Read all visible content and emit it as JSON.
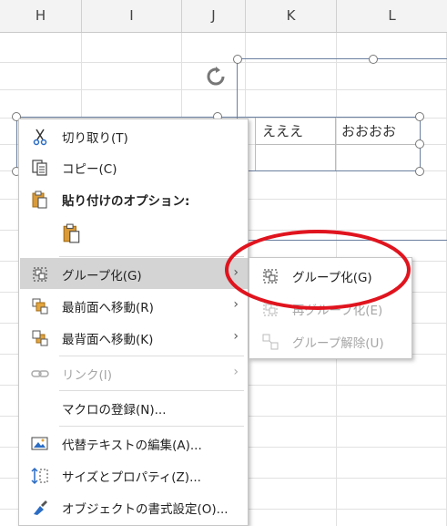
{
  "columns": [
    "H",
    "I",
    "J",
    "K",
    "L"
  ],
  "table_cells": [
    "えええ",
    "おおおお"
  ],
  "context_menu": {
    "items": [
      {
        "label": "切り取り(T)",
        "icon": "scissors-icon"
      },
      {
        "label": "コピー(C)",
        "icon": "copy-icon"
      },
      {
        "label": "貼り付けのオプション:",
        "icon": "paste-options-icon"
      },
      {
        "label": "グループ化(G)",
        "icon": "group-icon",
        "highlighted": true,
        "submenu": true
      },
      {
        "label": "最前面へ移動(R)",
        "icon": "bring-front-icon",
        "submenu": true
      },
      {
        "label": "最背面へ移動(K)",
        "icon": "send-back-icon",
        "submenu": true
      },
      {
        "label": "リンク(I)",
        "icon": "link-icon",
        "disabled": true,
        "submenu": true
      },
      {
        "label": "マクロの登録(N)...",
        "icon": ""
      },
      {
        "label": "代替テキストの編集(A)...",
        "icon": "alt-text-icon"
      },
      {
        "label": "サイズとプロパティ(Z)...",
        "icon": "size-properties-icon"
      },
      {
        "label": "オブジェクトの書式設定(O)...",
        "icon": "format-object-icon"
      }
    ]
  },
  "submenu": {
    "items": [
      {
        "label": "グループ化(G)",
        "icon": "group-icon",
        "disabled": false
      },
      {
        "label": "再グループ化(E)",
        "icon": "regroup-icon",
        "disabled": true
      },
      {
        "label": "グループ解除(U)",
        "icon": "ungroup-icon",
        "disabled": true
      }
    ]
  },
  "colors": {
    "highlight": "#d4d4d4",
    "annotation_red": "#e0141e",
    "shape_border": "#6b7fa0"
  }
}
